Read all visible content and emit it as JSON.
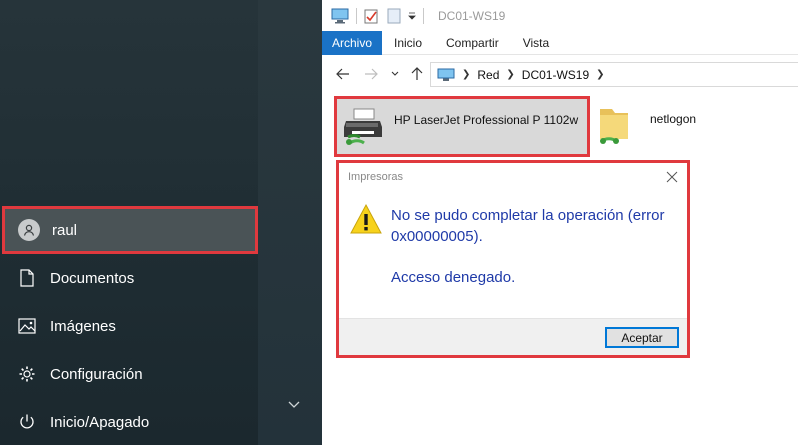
{
  "start_menu": {
    "user": {
      "name": "raul",
      "icon": "user-avatar-icon"
    },
    "items": [
      {
        "label": "Documentos",
        "icon": "document-icon"
      },
      {
        "label": "Imágenes",
        "icon": "image-icon"
      },
      {
        "label": "Configuración",
        "icon": "gear-icon"
      },
      {
        "label": "Inicio/Apagado",
        "icon": "power-icon"
      }
    ]
  },
  "explorer": {
    "window_title": "DC01-WS19",
    "ribbon_tabs": [
      "Archivo",
      "Inicio",
      "Compartir",
      "Vista"
    ],
    "breadcrumb": [
      "Red",
      "DC01-WS19"
    ],
    "items": [
      {
        "label": "HP LaserJet Professional P 1102w",
        "type": "printer"
      },
      {
        "label": "netlogon",
        "type": "shared-folder"
      }
    ]
  },
  "dialog": {
    "title": "Impresoras",
    "message_line1": "No se pudo completar la operación (error 0x00000005).",
    "message_line2": "Acceso denegado.",
    "accept_label": "Aceptar"
  },
  "colors": {
    "highlight_red": "#e0393e",
    "ribbon_blue": "#1a72c6",
    "message_blue": "#1f3aa8"
  }
}
